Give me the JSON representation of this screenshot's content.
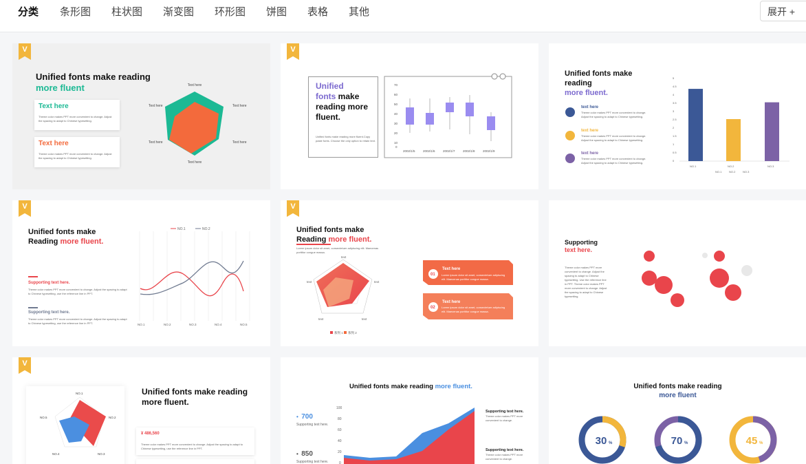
{
  "nav": {
    "tabs": [
      "分类",
      "条形图",
      "柱状图",
      "渐变图",
      "环形图",
      "饼图",
      "表格",
      "其他"
    ],
    "expand_label": "展开 +"
  },
  "ribbon_letter": "V",
  "cards": {
    "radar1": {
      "title_a": "Unified fonts make reading",
      "title_b": "more fluent",
      "box1": "Text here",
      "box2": "Text here",
      "body": "Theme color makes PPT more convenient to change. Adjust the spacing to adapt to Chinese typesetting.",
      "labels": [
        "Text here",
        "Text here",
        "Text here",
        "Text here",
        "Text here",
        "Text here"
      ]
    },
    "candle": {
      "title_a": "Unified",
      "title_b": "fonts",
      "title_c": "make reading more fluent.",
      "body": "Unified fonts make reading more fluent.Copy paste fonts. Choose the only option to retain text.",
      "y_ticks": [
        "70",
        "60",
        "50",
        "40",
        "30",
        "20",
        "10",
        "0"
      ],
      "x_ticks": [
        "2002/1/5",
        "2002/1/6",
        "2002/1/7",
        "2002/1/8",
        "2002/1/9"
      ]
    },
    "bars": {
      "title_a": "Unified fonts make reading",
      "title_b": "more fluent.",
      "items": [
        {
          "label": "text here",
          "body": "Theme color makes PPT more convenient to change. Adjust the spacing to adapt to Chinese typesetting."
        },
        {
          "label": "text here",
          "body": "Theme color makes PPT more convenient to change. Adjust the spacing to adapt to Chinese typesetting."
        },
        {
          "label": "text here",
          "body": "Theme color makes PPT more convenient to change. Adjust the spacing to adapt to Chinese typesetting."
        }
      ],
      "y_ticks": [
        "5",
        "4.5",
        "4",
        "3.5",
        "3",
        "2.5",
        "2",
        "1.5",
        "1",
        "0.5",
        "0"
      ],
      "categories": [
        "NO.1",
        "NO.2",
        "NO.3"
      ],
      "legend": [
        "NO.1",
        "NO.2",
        "NO.3"
      ]
    },
    "lines": {
      "title_a": "Unified fonts make",
      "title_b": "Reading",
      "title_c": "more fluent.",
      "legend": [
        "NO.1",
        "NO.2"
      ],
      "sup1": "Supporting text here.",
      "sup2": "Supporting text here.",
      "body": "Theme color makes PPT more convenient to change. Adjust the spacing to adapt to Chinese typesetting, use the reference line in PPT.",
      "x_ticks": [
        "NO.1",
        "NO.2",
        "NO.3",
        "NO.4",
        "NO.5"
      ]
    },
    "radar2": {
      "title_a": "Unified fonts make",
      "title_b": "Reading",
      "title_c": "more fluent.",
      "body": "Lorem ipsum dolor sit amet, consectetuer adipiscing elit. Maecenas porttitor congue massa.",
      "labels": [
        "text",
        "text",
        "text",
        "text",
        "text"
      ],
      "legend": [
        "系列 1",
        "系列 2"
      ],
      "box_title": "Text here",
      "box_body": "Lorem ipsum dolor sit amet, consectetuer adipiscing elit. Maecenas porttitor congue massa.",
      "n1": "01",
      "n2": "02"
    },
    "bubble": {
      "title_a": "Supporting",
      "title_b": "text here.",
      "body": "Theme color makes PPT more convenient to change. Adjust the spacing to adapt to Chinese typesetting. Use the reference line in PPT. Theme color makes PPT more convenient to change. Adjust the spacing to adapt to Chinese typesetting."
    },
    "radar3": {
      "title": "Unified fonts make reading more fluent.",
      "labels": [
        "NO.1",
        "NO.2",
        "NO.3",
        "NO.4",
        "NO.5"
      ],
      "amount": "¥ 486,560",
      "body": "Theme color makes PPT more convenient to change. Adjust the spacing to adapt to Chinese typesetting, use the reference line in PPT."
    },
    "area": {
      "title_a": "Unified fonts make reading",
      "title_b": "more fluent.",
      "stat1": "700",
      "stat2": "850",
      "stat_label": "Supporting text here.",
      "y_ticks": [
        "100",
        "80",
        "60",
        "40",
        "20",
        "0"
      ],
      "side1": "Supporting text here.",
      "side2": "Supporting text here.",
      "side_body": "Theme color makes PPT more convenient to change."
    },
    "donut": {
      "title_a": "Unified fonts make reading",
      "title_b": "more fluent",
      "values": [
        "30",
        "70",
        "45"
      ],
      "unit": "%"
    }
  },
  "colors": {
    "accent": "#e9454b",
    "teal": "#1cb994",
    "orange": "#f36a3c",
    "purple": "#7c6acf",
    "navy": "#3b5896",
    "gold": "#f2b63c",
    "blue": "#4a8fe0"
  },
  "chart_data": [
    {
      "type": "bar",
      "categories": [
        "NO.1",
        "NO.2",
        "NO.3"
      ],
      "values": [
        4.3,
        2.5,
        3.5
      ],
      "ylim": [
        0,
        5
      ]
    },
    {
      "type": "line",
      "categories": [
        "NO.1",
        "NO.2",
        "NO.3",
        "NO.4",
        "NO.5"
      ],
      "series": [
        {
          "name": "NO.1",
          "values": [
            4.2,
            6.6,
            4.8,
            2.4,
            4.2
          ]
        },
        {
          "name": "NO.2",
          "values": [
            6.4,
            4.4,
            2.2,
            6.2,
            8.4
          ]
        }
      ]
    },
    {
      "type": "pie",
      "values": [
        30,
        70,
        45
      ],
      "unit": "%"
    }
  ]
}
